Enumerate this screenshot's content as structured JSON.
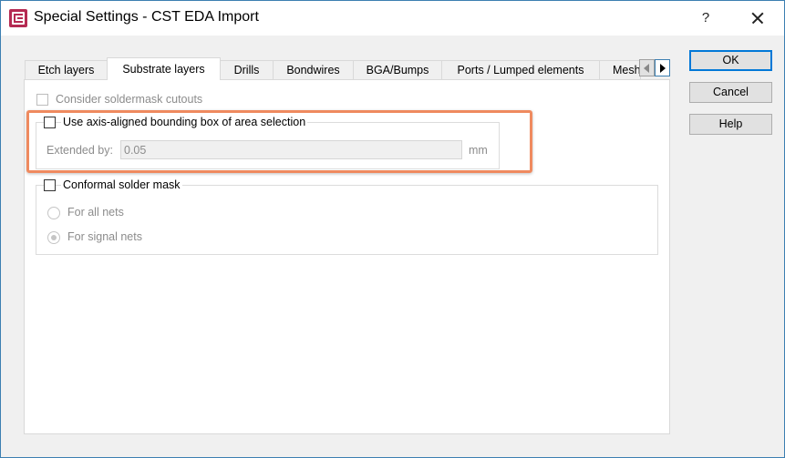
{
  "window": {
    "title": "Special Settings - CST EDA Import",
    "help_glyph": "?",
    "icon": "cst-app-icon"
  },
  "tabs": [
    {
      "label": "Etch layers"
    },
    {
      "label": "Substrate layers",
      "active": true
    },
    {
      "label": "Drills"
    },
    {
      "label": "Bondwires"
    },
    {
      "label": "BGA/Bumps"
    },
    {
      "label": "Ports / Lumped elements"
    },
    {
      "label": "Mesh"
    }
  ],
  "substrate": {
    "soldermask_cutouts_label": "Consider soldermask cutouts",
    "bbox_label": "Use axis-aligned bounding box of area selection",
    "extended_by_label": "Extended by:",
    "extended_by_value": "0.05",
    "extended_by_unit": "mm",
    "conformal_label": "Conformal solder mask",
    "for_all_nets_label": "For all nets",
    "for_signal_nets_label": "For signal nets"
  },
  "buttons": {
    "ok": "OK",
    "cancel": "Cancel",
    "help": "Help"
  },
  "colors": {
    "highlight": "#ef8a5f",
    "default_button_border": "#0078d7",
    "window_border": "#3c7fb1"
  }
}
